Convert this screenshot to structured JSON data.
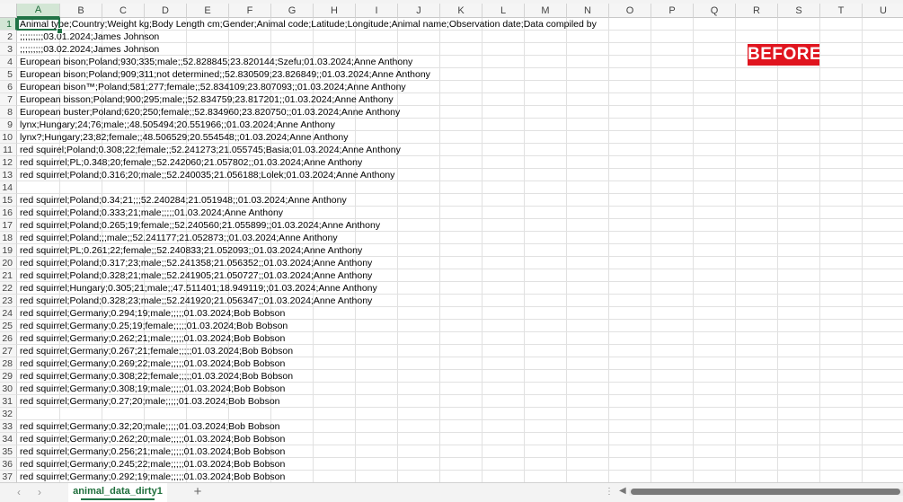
{
  "columns": [
    "A",
    "B",
    "C",
    "D",
    "E",
    "F",
    "G",
    "H",
    "I",
    "J",
    "K",
    "L",
    "M",
    "N",
    "O",
    "P",
    "Q",
    "R",
    "S",
    "T",
    "U"
  ],
  "rows": [
    {
      "n": "1",
      "t": "Animal type;Country;Weight kg;Body Length cm;Gender;Animal code;Latitude;Longitude;Animal name;Observation date;Data compiled by"
    },
    {
      "n": "2",
      "t": ";;;;;;;;;03.01.2024;James Johnson"
    },
    {
      "n": "3",
      "t": ";;;;;;;;;03.02.2024;James Johnson"
    },
    {
      "n": "4",
      "t": "European bison;Poland;930;335;male;;52.828845;23.820144;Szefu;01.03.2024;Anne Anthony"
    },
    {
      "n": "5",
      "t": "European bison;Poland;909;311;not determined;;52.830509;23.826849;;01.03.2024;Anne Anthony"
    },
    {
      "n": "6",
      "t": "European bison™;Poland;581;277;female;;52.834109;23.807093;;01.03.2024;Anne Anthony"
    },
    {
      "n": "7",
      "t": "European bisson;Poland;900;295;male;;52.834759;23.817201;;01.03.2024;Anne Anthony"
    },
    {
      "n": "8",
      "t": "European buster;Poland;620;250;female;;52.834960;23.820750;;01.03.2024;Anne Anthony"
    },
    {
      "n": "9",
      "t": "lynx;Hungary;24;76;male;;48.505494;20.551966;;01.03.2024;Anne Anthony"
    },
    {
      "n": "10",
      "t": "lynx?;Hungary;23;82;female;;48.506529;20.554548;;01.03.2024;Anne Anthony"
    },
    {
      "n": "11",
      "t": "red squirel;Poland;0.308;22;female;;52.241273;21.055745;Basia;01.03.2024;Anne Anthony"
    },
    {
      "n": "12",
      "t": "red squirrel;PL;0.348;20;female;;52.242060;21.057802;;01.03.2024;Anne Anthony"
    },
    {
      "n": "13",
      "t": "red squirrel;Poland;0.316;20;male;;52.240035;21.056188;Lolek;01.03.2024;Anne Anthony"
    },
    {
      "n": "14",
      "t": ""
    },
    {
      "n": "15",
      "t": "red squirrel;Poland;0.34;21;;;52.240284;21.051948;;01.03.2024;Anne Anthony"
    },
    {
      "n": "16",
      "t": "red squirrel;Poland;0.333;21;male;;;;;01.03.2024;Anne Anthony"
    },
    {
      "n": "17",
      "t": "red squirrel;Poland;0.265;19;female;;52.240560;21.055899;;01.03.2024;Anne Anthony"
    },
    {
      "n": "18",
      "t": "red squirrel;Poland;;;male;;52.241177;21.052873;;01.03.2024;Anne Anthony"
    },
    {
      "n": "19",
      "t": "red squirrel;PL;0.261;22;female;;52.240833;21.052093;;01.03.2024;Anne Anthony"
    },
    {
      "n": "20",
      "t": "red squirrel;Poland;0.317;23;male;;52.241358;21.056352;;01.03.2024;Anne Anthony"
    },
    {
      "n": "21",
      "t": "red squirrel;Poland;0.328;21;male;;52.241905;21.050727;;01.03.2024;Anne Anthony"
    },
    {
      "n": "22",
      "t": "red squirrel;Hungary;0.305;21;male;;47.511401;18.949119;;01.03.2024;Anne Anthony"
    },
    {
      "n": "23",
      "t": "red squirrel;Poland;0.328;23;male;;52.241920;21.056347;;01.03.2024;Anne Anthony"
    },
    {
      "n": "24",
      "t": "red squirrel;Germany;0.294;19;male;;;;;01.03.2024;Bob Bobson"
    },
    {
      "n": "25",
      "t": "red squirrel;Germany;0.25;19;female;;;;;01.03.2024;Bob Bobson"
    },
    {
      "n": "26",
      "t": "red squirrel;Germany;0.262;21;male;;;;;01.03.2024;Bob Bobson"
    },
    {
      "n": "27",
      "t": "red squirrel;Germany;0.267;21;female;;;;;01.03.2024;Bob Bobson"
    },
    {
      "n": "28",
      "t": "red squirrel;Germany;0.269;22;male;;;;;01.03.2024;Bob Bobson"
    },
    {
      "n": "29",
      "t": "red squirrel;Germany;0.308;22;female;;;;;01.03.2024;Bob Bobson"
    },
    {
      "n": "30",
      "t": "red squirrel;Germany;0.308;19;male;;;;;01.03.2024;Bob Bobson"
    },
    {
      "n": "31",
      "t": "red squirrel;Germany;0.27;20;male;;;;;01.03.2024;Bob Bobson"
    },
    {
      "n": "32",
      "t": ""
    },
    {
      "n": "33",
      "t": "red squirrel;Germany;0.32;20;male;;;;;01.03.2024;Bob Bobson"
    },
    {
      "n": "34",
      "t": "red squirrel;Germany;0.262;20;male;;;;;01.03.2024;Bob Bobson"
    },
    {
      "n": "35",
      "t": "red squirrel;Germany;0.256;21;male;;;;;01.03.2024;Bob Bobson"
    },
    {
      "n": "36",
      "t": "red squirrel;Germany;0.245;22;male;;;;;01.03.2024;Bob Bobson"
    },
    {
      "n": "37",
      "t": "red squirrel;Germany;0.292;19;male;;;;;01.03.2024;Bob Bobson"
    }
  ],
  "badge": {
    "text": "BEFORE",
    "color": "#e0141e"
  },
  "sheet_tab": {
    "label": "animal_data_dirty1"
  },
  "add_sheet": {
    "label": "+"
  },
  "nav": {
    "prev_icon": "‹",
    "next_icon": "›"
  },
  "scroll": {
    "dots": "⋮",
    "left_icon": "◀"
  },
  "accent_color": "#217346"
}
